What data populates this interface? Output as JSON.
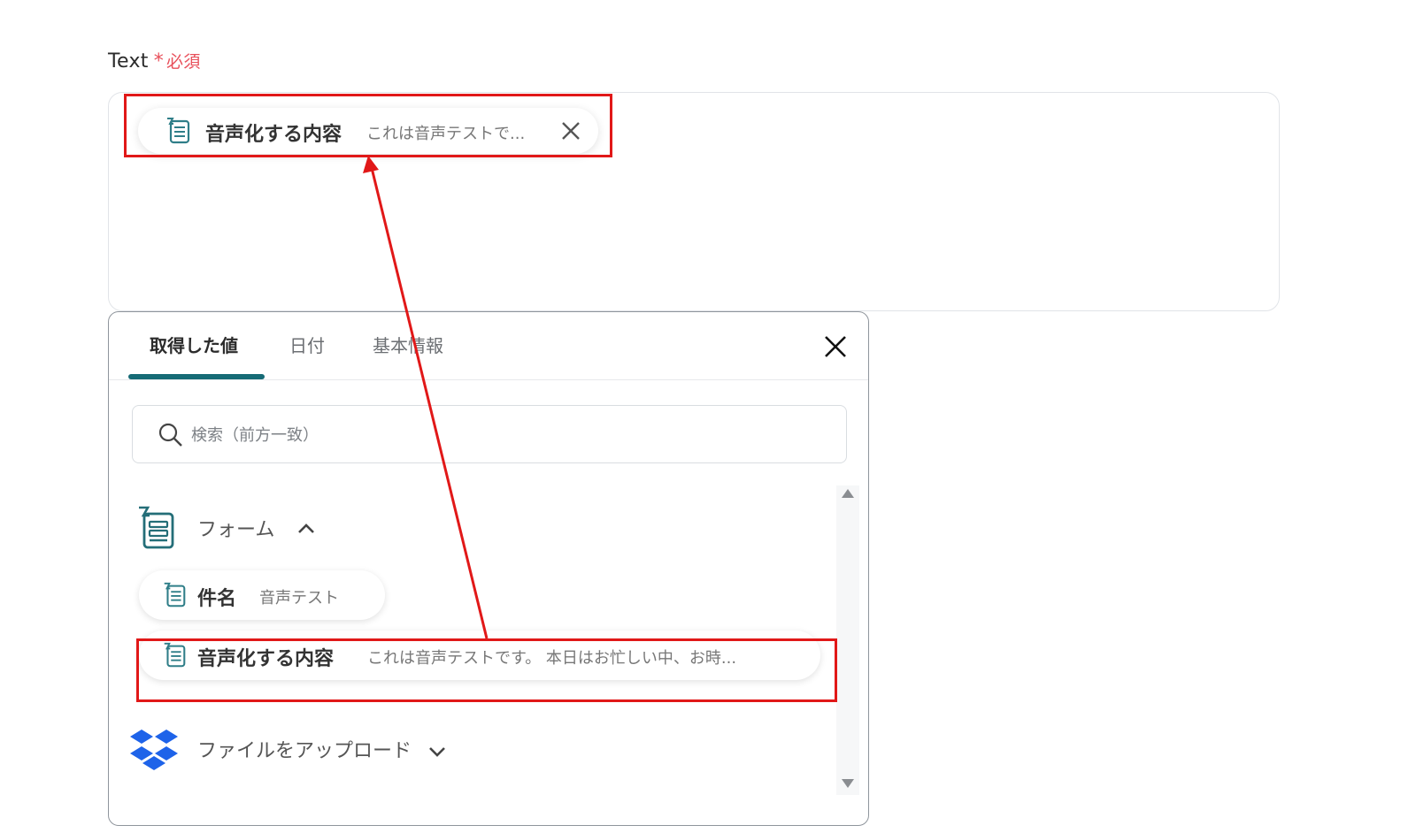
{
  "field": {
    "label": "Text",
    "required_star": "*",
    "required_text": "必須"
  },
  "selected_token": {
    "icon": "form-icon",
    "name": "音声化する内容",
    "preview": "これは音声テストで..."
  },
  "picker": {
    "tabs": [
      {
        "label": "取得した値",
        "active": true
      },
      {
        "label": "日付",
        "active": false
      },
      {
        "label": "基本情報",
        "active": false
      }
    ],
    "search": {
      "placeholder": "検索（前方一致）",
      "value": ""
    },
    "groups": [
      {
        "icon": "form-icon",
        "label": "フォーム",
        "expanded": true,
        "items": [
          {
            "name": "件名",
            "preview": "音声テスト"
          },
          {
            "name": "音声化する内容",
            "preview": "これは音声テストです。 本日はお忙しい中、お時..."
          }
        ]
      },
      {
        "icon": "dropbox-icon",
        "label": "ファイルをアップロード",
        "expanded": false
      }
    ]
  },
  "colors": {
    "accent_teal": "#166b76",
    "required_red": "#e8505b",
    "highlight_red": "#e11818"
  }
}
